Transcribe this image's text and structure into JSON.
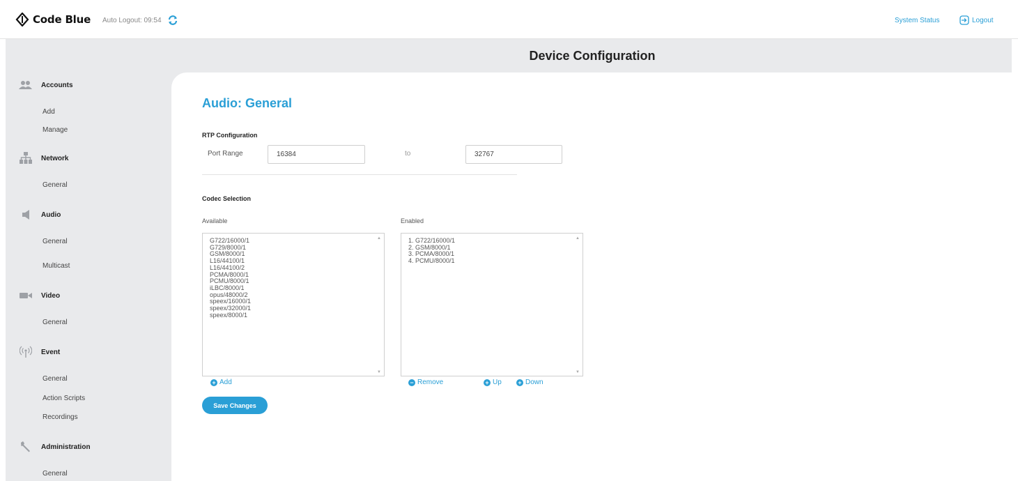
{
  "header": {
    "logo_text": "Code Blue",
    "auto_logout": "Auto Logout: 09:54",
    "system_status": "System Status",
    "logout": "Logout",
    "accent_color": "#2a9fd6"
  },
  "page_title": "Device Configuration",
  "sidebar": {
    "sections": [
      {
        "label": "Accounts",
        "icon": "users-icon",
        "items": [
          "Add",
          "Manage"
        ]
      },
      {
        "label": "Network",
        "icon": "network-icon",
        "items": [
          "General"
        ]
      },
      {
        "label": "Audio",
        "icon": "speaker-icon",
        "items": [
          "General",
          "Multicast"
        ]
      },
      {
        "label": "Video",
        "icon": "video-camera-icon",
        "items": [
          "General"
        ]
      },
      {
        "label": "Event",
        "icon": "broadcast-icon",
        "items": [
          "General",
          "Action Scripts",
          "Recordings"
        ]
      },
      {
        "label": "Administration",
        "icon": "wrench-icon",
        "items": [
          "General"
        ]
      }
    ]
  },
  "main": {
    "heading": "Audio: General",
    "rtp": {
      "title": "RTP Configuration",
      "port_range_label": "Port Range",
      "port_start": "16384",
      "to_label": "to",
      "port_end": "32767"
    },
    "codec": {
      "title": "Codec Selection",
      "available_label": "Available",
      "enabled_label": "Enabled",
      "available": [
        "G722/16000/1",
        "G729/8000/1",
        "GSM/8000/1",
        "L16/44100/1",
        "L16/44100/2",
        "PCMA/8000/1",
        "PCMU/8000/1",
        "iLBC/8000/1",
        "opus/48000/2",
        "speex/16000/1",
        "speex/32000/1",
        "speex/8000/1"
      ],
      "enabled": [
        "1. G722/16000/1",
        "2. GSM/8000/1",
        "3. PCMA/8000/1",
        "4. PCMU/8000/1"
      ],
      "add_label": "Add",
      "remove_label": "Remove",
      "up_label": "Up",
      "down_label": "Down"
    },
    "save_label": "Save Changes"
  }
}
